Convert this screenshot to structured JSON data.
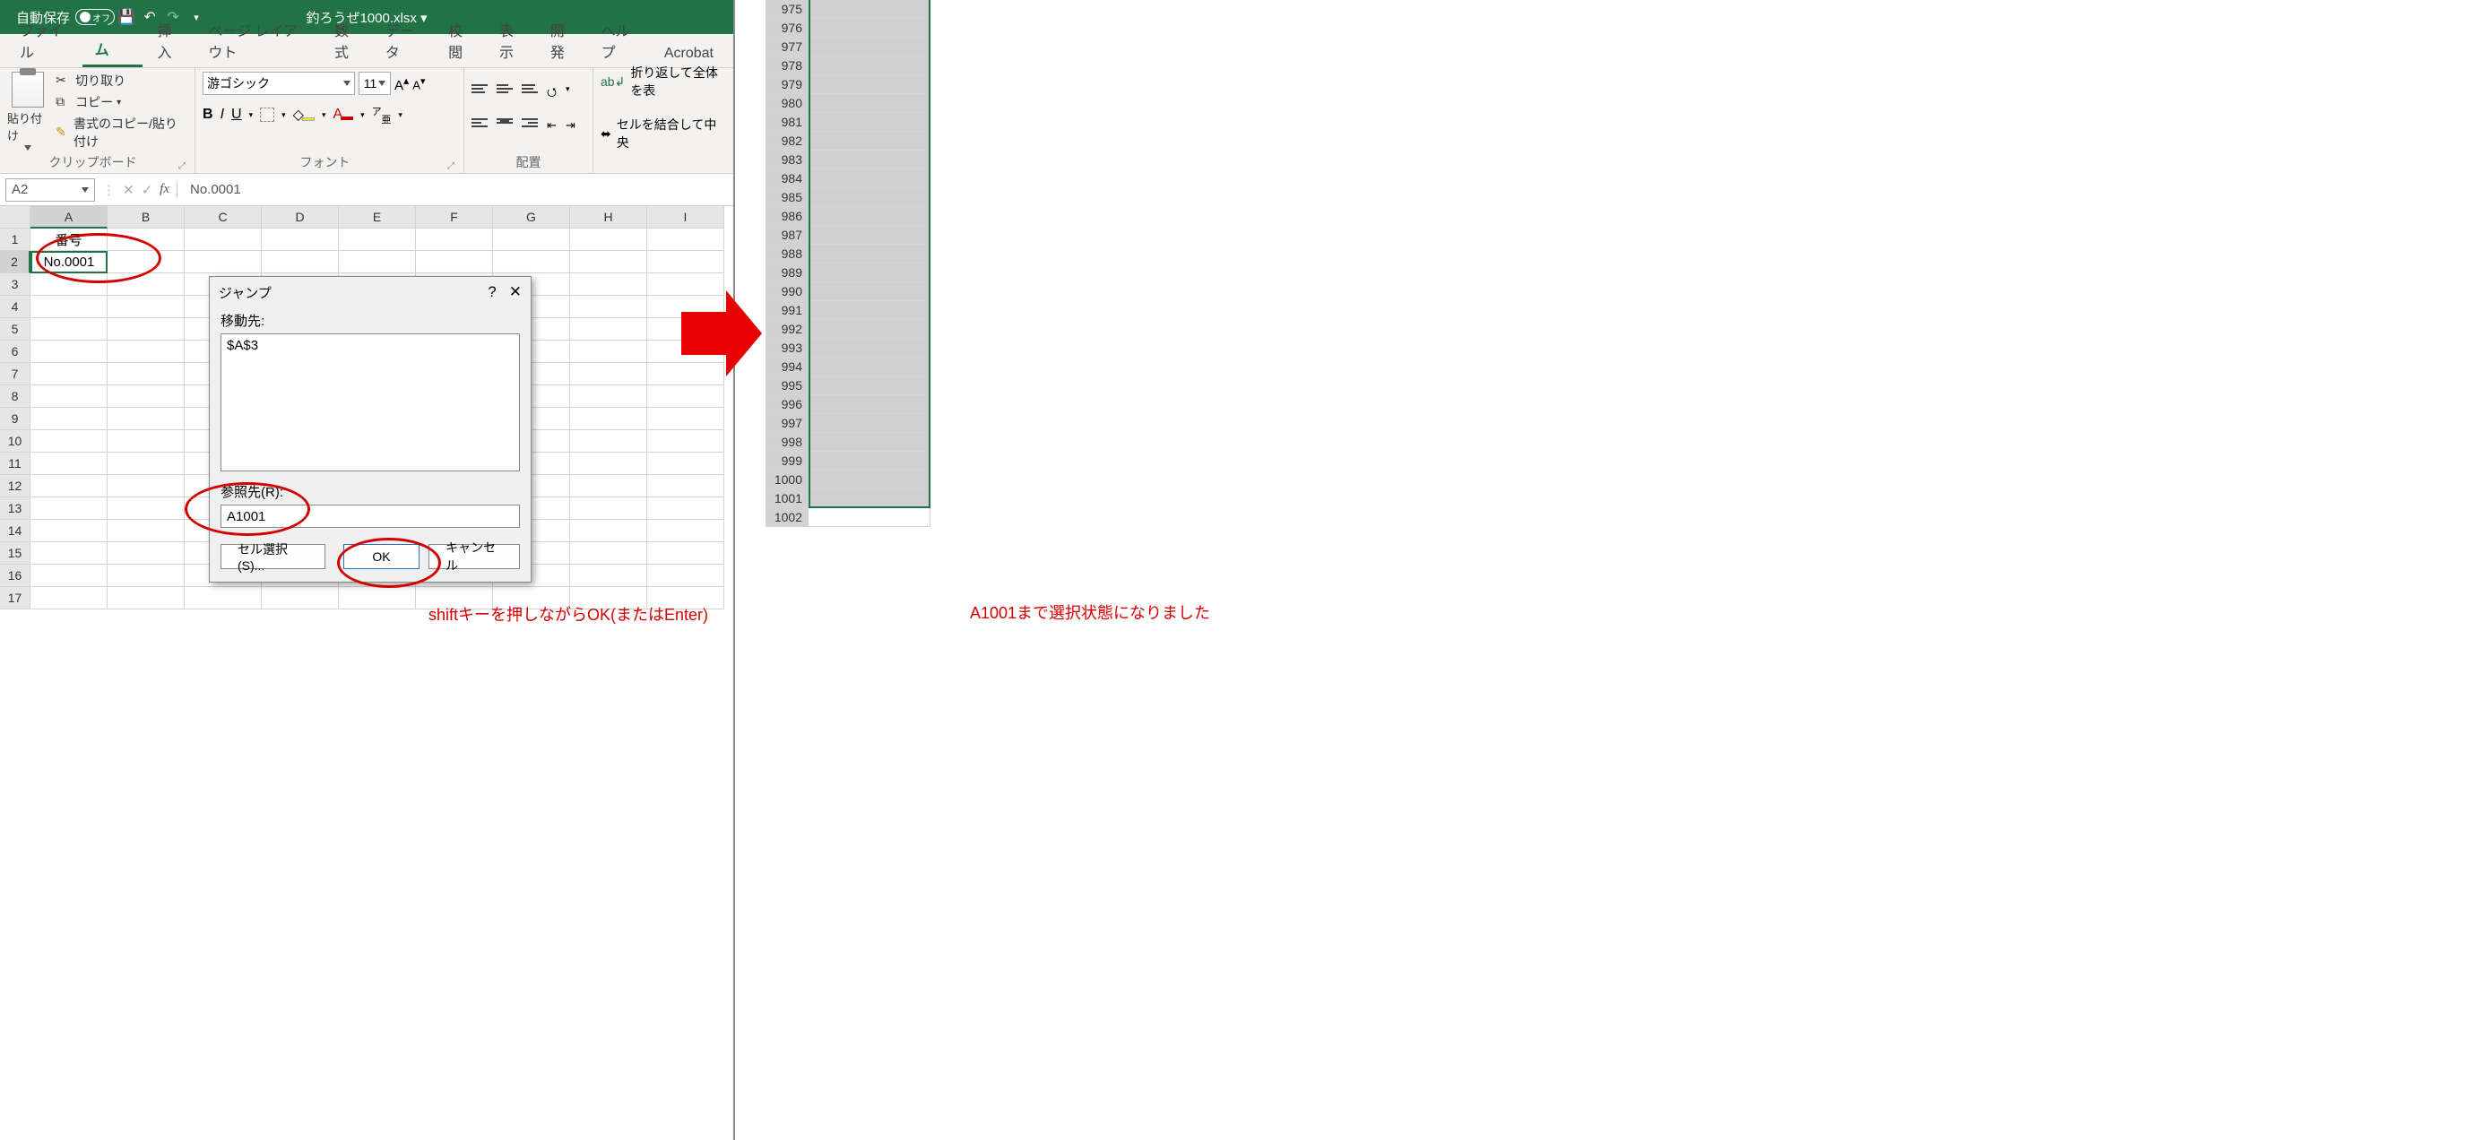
{
  "titlebar": {
    "autosave_label": "自動保存",
    "autosave_state": "オフ",
    "filename": "釣ろうぜ1000.xlsx ▾"
  },
  "tabs": {
    "file": "ファイル",
    "home": "ホーム",
    "insert": "挿入",
    "pagelayout": "ページ レイアウト",
    "formulas": "数式",
    "data": "データ",
    "review": "校閲",
    "view": "表示",
    "developer": "開発",
    "help": "ヘルプ",
    "acrobat": "Acrobat"
  },
  "ribbon": {
    "clipboard": {
      "paste": "貼り付け",
      "cut": "切り取り",
      "copy": "コピー",
      "formatpainter": "書式のコピー/貼り付け",
      "group": "クリップボード"
    },
    "font": {
      "name": "游ゴシック",
      "size": "11",
      "group": "フォント"
    },
    "align": {
      "group": "配置",
      "wrap": "折り返して全体を表",
      "merge": "セルを結合して中央"
    }
  },
  "formula_bar": {
    "namebox": "A2",
    "value": "No.0001"
  },
  "columns": [
    "A",
    "B",
    "C",
    "D",
    "E",
    "F",
    "G",
    "H",
    "I"
  ],
  "rows_left": [
    "1",
    "2",
    "3",
    "4",
    "5",
    "6",
    "7",
    "8",
    "9",
    "10",
    "11",
    "12",
    "13",
    "14",
    "15",
    "16",
    "17"
  ],
  "cells": {
    "A1": "番号",
    "A2": "No.0001"
  },
  "dialog": {
    "title": "ジャンプ",
    "goto_label": "移動先:",
    "goto_list_item": "$A$3",
    "ref_label": "参照先(R):",
    "ref_value": "A1001",
    "special": "セル選択(S)...",
    "ok": "OK",
    "cancel": "キャンセル",
    "help": "?",
    "close": "✕"
  },
  "note1": "shiftキーを押しながらOK(またはEnter)",
  "note2": "A1001まで選択状態になりました",
  "right_rows_start": 975,
  "right_rows_end": 1002
}
